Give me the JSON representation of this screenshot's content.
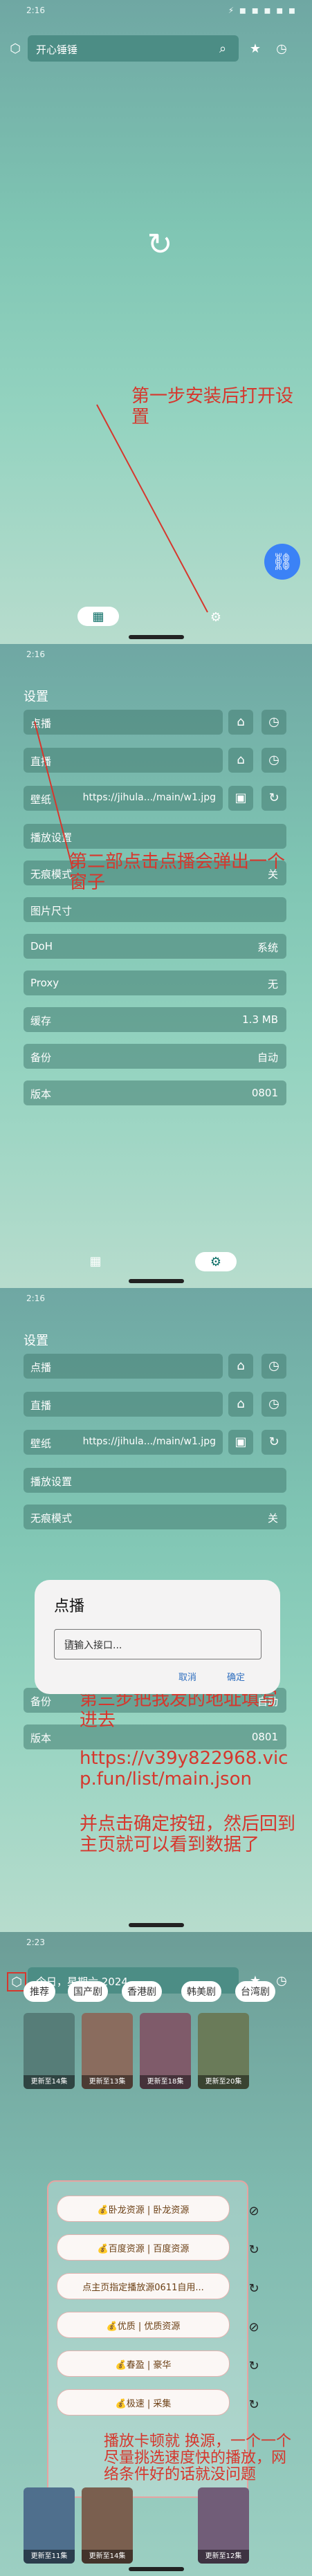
{
  "frame1": {
    "status_time": "2:16",
    "status_icons": "⚡ ◼ ◼ ◼ ◼ ◼",
    "search_text": "开心锤锤",
    "note": "第一步安装后打开设置"
  },
  "frame2": {
    "status_time": "2:16",
    "heading": "设置",
    "rows": [
      {
        "label": "点播"
      },
      {
        "label": "直播"
      },
      {
        "label": "壁纸",
        "value": "https://jihula.../main/w1.jpg"
      }
    ],
    "full_rows": [
      {
        "label": "播放设置",
        "value": ""
      },
      {
        "label": "无痕模式",
        "value": "关"
      },
      {
        "label": "图片尺寸",
        "value": ""
      },
      {
        "label": "DoH",
        "value": "系统"
      },
      {
        "label": "Proxy",
        "value": "无"
      },
      {
        "label": "缓存",
        "value": "1.3 MB"
      },
      {
        "label": "备份",
        "value": "自动"
      },
      {
        "label": "版本",
        "value": "0801"
      }
    ],
    "note": "第二部点击点播会弹出一个窗子"
  },
  "frame3": {
    "status_time": "2:16",
    "heading": "设置",
    "rows": [
      {
        "label": "点播"
      },
      {
        "label": "直播"
      },
      {
        "label": "壁纸",
        "value": "https://jihula.../main/w1.jpg"
      }
    ],
    "full_rows": [
      {
        "label": "播放设置",
        "value": ""
      },
      {
        "label": "无痕模式",
        "value": "关"
      },
      {
        "label": "备份",
        "value": "自动"
      },
      {
        "label": "版本",
        "value": "0801"
      }
    ],
    "dialog": {
      "title": "点播",
      "placeholder": "请输入接口...",
      "cancel": "取消",
      "confirm": "确定"
    },
    "note1": "第三步把我发的地址填写进去",
    "note2": "https://v39y822968.vicp.fun/list/main.json",
    "note3": "并点击确定按钮，然后回到主页就可以看到数据了"
  },
  "frame4": {
    "status_time": "2:23",
    "search_text": "今日，星期六 2024",
    "chips": [
      "推荐",
      "国产剧",
      "香港剧",
      "韩美剧",
      "台湾剧"
    ],
    "sources": [
      "💰卧龙资源 | 卧龙资源",
      "💰百度资源 | 百度资源",
      "点主页指定播放源0611自用...",
      "💰优质 | 优质资源",
      "💰春盈 | 豪华",
      "💰极速 | 采集"
    ],
    "tile_labels": [
      "更新至14集",
      "更新至13集",
      "更新至18集",
      "更新至20集",
      "更新至11集",
      "更新至14集",
      "更新至12集"
    ],
    "note": "播放卡顿就 换源，一个一个尽量挑选速度快的播放，网络条件好的话就没问题"
  }
}
